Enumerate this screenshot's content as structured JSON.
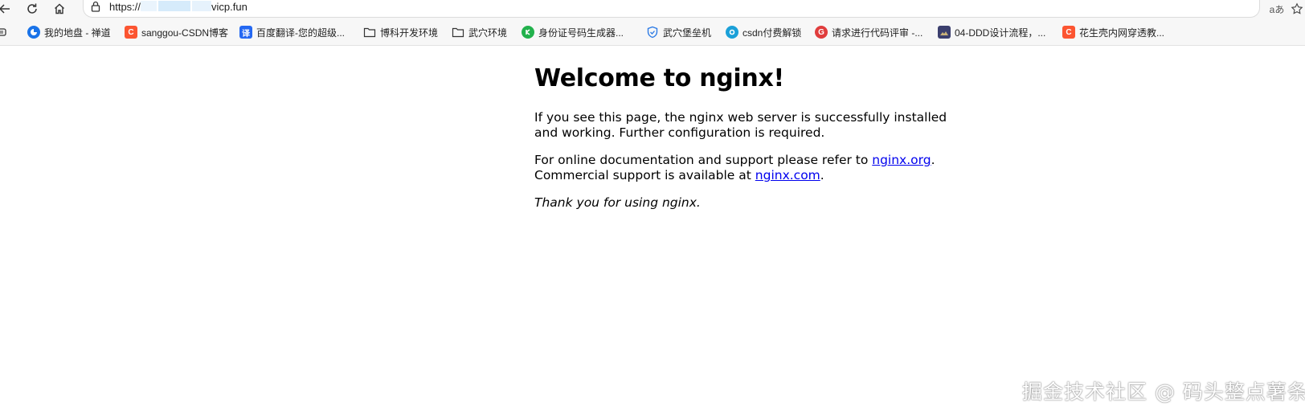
{
  "browser": {
    "url": {
      "prefix": "https://",
      "suffix": "vicp.fun"
    },
    "reader_label": "aあ"
  },
  "bookmarks": [
    {
      "label": "我的地盘 - 禅道",
      "icon": "zentao-icon",
      "icon_text": "",
      "color": "#1a73e8"
    },
    {
      "label": "sanggou-CSDN博客",
      "icon": "csdn-icon",
      "icon_text": "C",
      "color": "#fc5531"
    },
    {
      "label": "百度翻译-您的超级...",
      "icon": "baidu-translate-icon",
      "icon_text": "译",
      "color": "#2468f2"
    },
    {
      "label": "博科开发环境",
      "icon": "folder-icon",
      "icon_text": "",
      "color": ""
    },
    {
      "label": "武穴环境",
      "icon": "folder-icon",
      "icon_text": "",
      "color": ""
    },
    {
      "label": "身份证号码生成器...",
      "icon": "id-generator-icon",
      "icon_text": "",
      "color": "#22b14c"
    },
    {
      "label": "武穴堡垒机",
      "icon": "shield-icon",
      "icon_text": "",
      "color": "#2d7be5"
    },
    {
      "label": "csdn付费解锁",
      "icon": "csdn-unlock-icon",
      "icon_text": "",
      "color": "#1ba0d8"
    },
    {
      "label": "请求进行代码评审 -...",
      "icon": "gitlab-review-icon",
      "icon_text": "G",
      "color": "#e03d3d"
    },
    {
      "label": "04-DDD设计流程，...",
      "icon": "image-thumb-icon",
      "icon_text": "",
      "color": "#3b3f6e"
    },
    {
      "label": "花生壳内网穿透教...",
      "icon": "csdn-icon",
      "icon_text": "C",
      "color": "#fc5531"
    }
  ],
  "main": {
    "heading": "Welcome to nginx!",
    "para1": "If you see this page, the nginx web server is successfully installed and working. Further configuration is required.",
    "para2_prefix": "For online documentation and support please refer to ",
    "link1": "nginx.org",
    "para2_mid": ".",
    "para2_line2": "Commercial support is available at ",
    "link2": "nginx.com",
    "para2_end": ".",
    "thanks": "Thank you for using nginx."
  },
  "watermark": "掘金技术社区 @ 码头整点薯条"
}
